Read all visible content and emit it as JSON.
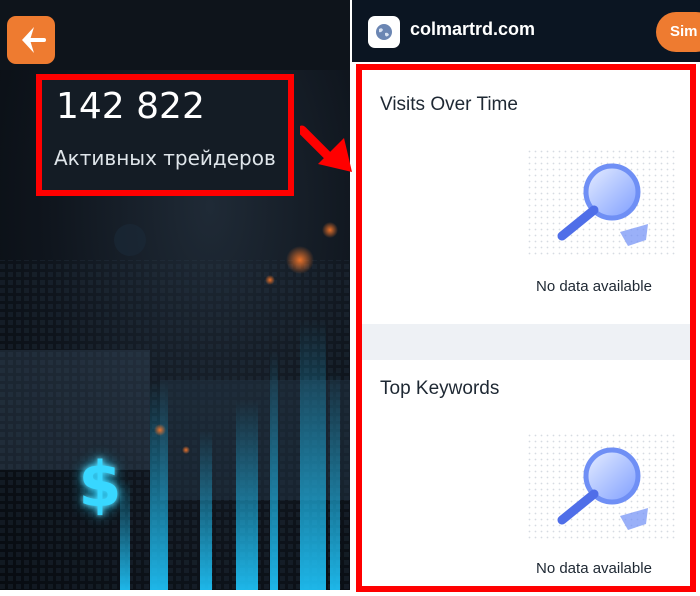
{
  "left_panel": {
    "logo_icon": "arrow-left-icon",
    "metric": {
      "value": "142 822",
      "label": "Активных трейдеров"
    },
    "currency_icon": "$"
  },
  "right_panel": {
    "header": {
      "site_icon": "globe-icon",
      "site_name": "colmartrd.com",
      "button_label": "Sim"
    },
    "sections": [
      {
        "title": "Visits Over Time",
        "empty_text": "No data available",
        "empty_icon": "magnifier-icon"
      },
      {
        "title": "Top Keywords",
        "empty_text": "No data available",
        "empty_icon": "magnifier-icon"
      }
    ]
  },
  "colors": {
    "accent_orange": "#ee7b30",
    "highlight_red": "#ff0000",
    "header_dark": "#0b1522",
    "glow_cyan": "#38d7ff"
  }
}
